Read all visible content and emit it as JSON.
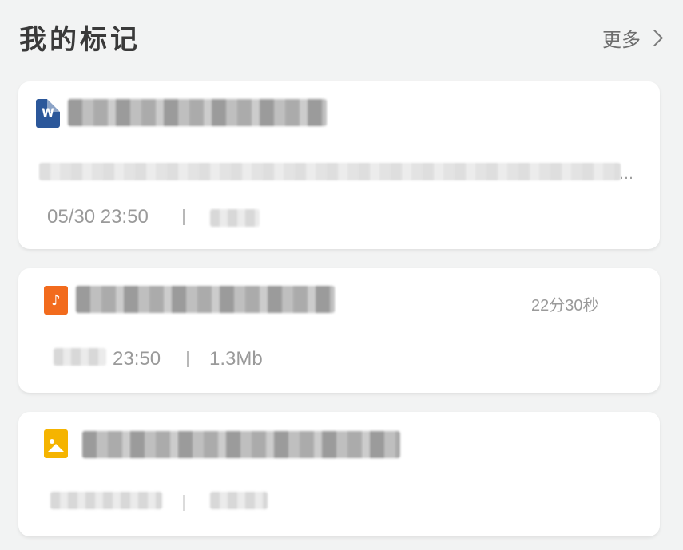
{
  "header": {
    "title": "我的标记",
    "more_label": "更多"
  },
  "items": [
    {
      "type": "word",
      "icon": "word-doc-icon",
      "timestamp": "05/30 23:50"
    },
    {
      "type": "audio",
      "icon": "audio-file-icon",
      "duration": "22分30秒",
      "timestamp_partial": "23:50",
      "size": "1.3Mb"
    },
    {
      "type": "image",
      "icon": "image-file-icon"
    }
  ],
  "colors": {
    "background": "#f2f3f3",
    "card": "#ffffff",
    "word_icon": "#2b579a",
    "audio_icon": "#f26b1d",
    "image_icon": "#f5b400",
    "meta_text": "#9a9a9a"
  }
}
